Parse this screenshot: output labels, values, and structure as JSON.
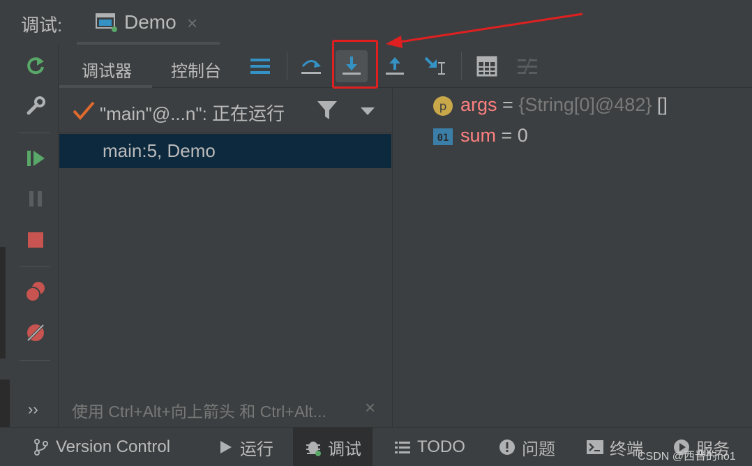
{
  "header": {
    "panel_label": "调试:",
    "tab": {
      "label": "Demo",
      "close": "×"
    }
  },
  "debug_tabs": {
    "debugger": "调试器",
    "console": "控制台"
  },
  "frames": {
    "thread_label": "\"main\"@...n\": 正在运行",
    "selected_frame": "main:5, Demo",
    "hint": "使用 Ctrl+Alt+向上箭头 和 Ctrl+Alt...",
    "hint_close": "×"
  },
  "variables": [
    {
      "icon_letter": "p",
      "name": "args",
      "eq": " = ",
      "value": "{String[0]@482}",
      "value_extra": " []"
    },
    {
      "icon_letter": "01",
      "name": "sum",
      "eq": " = ",
      "value": "",
      "value_extra": "0"
    }
  ],
  "side_toolbar": {
    "more": "››"
  },
  "bottom_bar": {
    "items": [
      {
        "label": "Version Control",
        "icon": "branch-icon"
      },
      {
        "label": "运行",
        "icon": "run-icon"
      },
      {
        "label": "调试",
        "icon": "bug-icon"
      },
      {
        "label": "TODO",
        "icon": "list-icon"
      },
      {
        "label": "问题",
        "icon": "alert-icon"
      },
      {
        "label": "终端",
        "icon": "terminal-icon"
      },
      {
        "label": "服务",
        "icon": "services-icon"
      }
    ]
  },
  "watermark": "CSDN @西晋的no1",
  "colors": {
    "background": "#3c3f41",
    "selection": "#0d293e",
    "accent_blue": "#3592c4",
    "var_name": "#ff8080",
    "annotation_red": "#e02020",
    "resume_green": "#59a869",
    "stop_red": "#c75450"
  }
}
